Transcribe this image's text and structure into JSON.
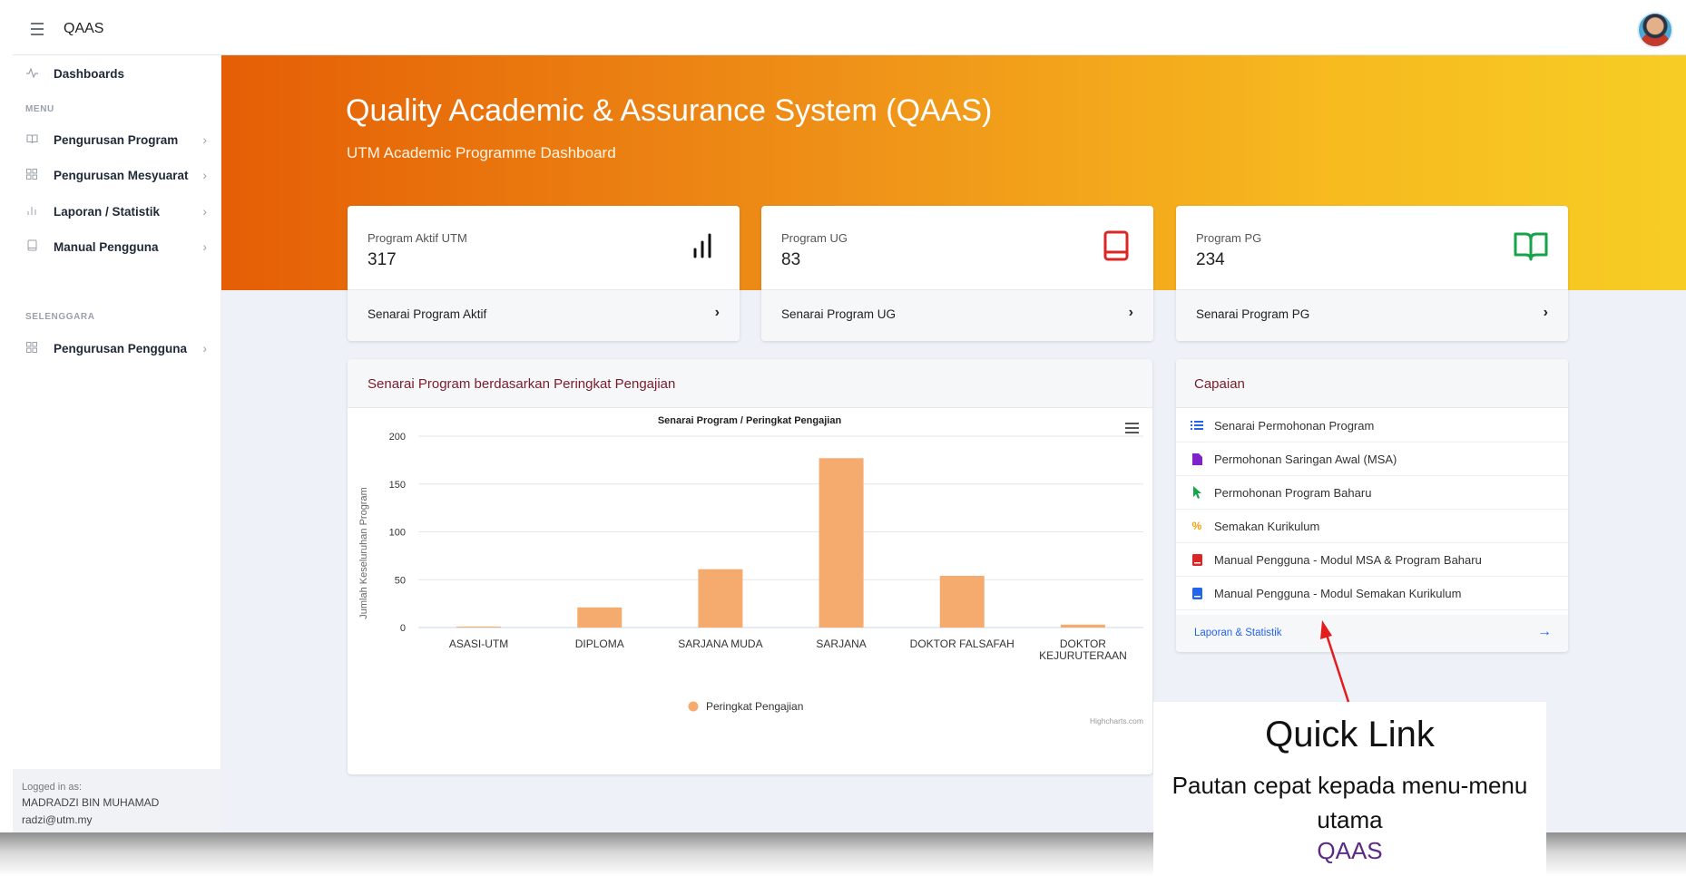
{
  "topbar": {
    "title": "QAAS"
  },
  "sidebar": {
    "dashboards": "Dashboards",
    "section_menu": "MENU",
    "items": [
      {
        "label": "Pengurusan Program",
        "icon": "book-open-icon"
      },
      {
        "label": "Pengurusan Mesyuarat",
        "icon": "grid-icon"
      },
      {
        "label": "Laporan / Statistik",
        "icon": "bar-chart-icon"
      },
      {
        "label": "Manual Pengguna",
        "icon": "book-icon"
      }
    ],
    "section_selenggara": "SELENGGARA",
    "admin_items": [
      {
        "label": "Pengurusan Pengguna",
        "icon": "grid-icon"
      }
    ],
    "footer": {
      "logged_label": "Logged in as:",
      "name": "MADRADZI BIN MUHAMAD",
      "email": "radzi@utm.my"
    }
  },
  "banner": {
    "title": "Quality Academic & Assurance System (QAAS)",
    "subtitle": "UTM Academic Programme Dashboard"
  },
  "stats": [
    {
      "label": "Program Aktif UTM",
      "value": "317",
      "link": "Senarai Program Aktif",
      "icon": "signal-bars-icon",
      "color": "#111111"
    },
    {
      "label": "Program UG",
      "value": "83",
      "link": "Senarai Program UG",
      "icon": "book-icon",
      "color": "#dc2626"
    },
    {
      "label": "Program PG",
      "value": "234",
      "link": "Senarai Program PG",
      "icon": "book-open-icon",
      "color": "#16a34a"
    }
  ],
  "chart_card": {
    "title": "Senarai Program berdasarkan Peringkat Pengajian"
  },
  "chart_data": {
    "type": "bar",
    "title": "Senarai Program / Peringkat Pengajian",
    "ylabel": "Jumlah Keseluruhan Program",
    "xlabel": "",
    "categories": [
      "ASASI-UTM",
      "DIPLOMA",
      "SARJANA MUDA",
      "SARJANA",
      "DOKTOR FALSAFAH",
      "DOKTOR KEJURUTERAAN"
    ],
    "series": [
      {
        "name": "Peringkat Pengajian",
        "values": [
          1,
          21,
          61,
          177,
          54,
          3
        ],
        "color": "#f5ab6e"
      }
    ],
    "ylim": [
      0,
      200
    ],
    "yticks": [
      0,
      50,
      100,
      150,
      200
    ],
    "grid": true,
    "legend": "bottom-center",
    "credit": "Highcharts.com"
  },
  "capaian": {
    "title": "Capaian",
    "items": [
      {
        "label": "Senarai Permohonan Program",
        "icon": "list-icon",
        "color": "#2563eb"
      },
      {
        "label": "Permohonan Saringan Awal (MSA)",
        "icon": "file-icon",
        "color": "#7e22ce"
      },
      {
        "label": "Permohonan Program Baharu",
        "icon": "pointer-icon",
        "color": "#16a34a"
      },
      {
        "label": "Semakan Kurikulum",
        "icon": "percent-icon",
        "color": "#f59e0b"
      },
      {
        "label": "Manual Pengguna - Modul MSA & Program Baharu",
        "icon": "book-icon",
        "color": "#dc2626"
      },
      {
        "label": "Manual Pengguna - Modul Semakan Kurikulum",
        "icon": "book-icon",
        "color": "#2563eb"
      }
    ],
    "footer": "Laporan & Statistik"
  },
  "annotation": {
    "title": "Quick Link",
    "body": "Pautan cepat kepada menu-menu utama",
    "qaas": "QAAS"
  }
}
